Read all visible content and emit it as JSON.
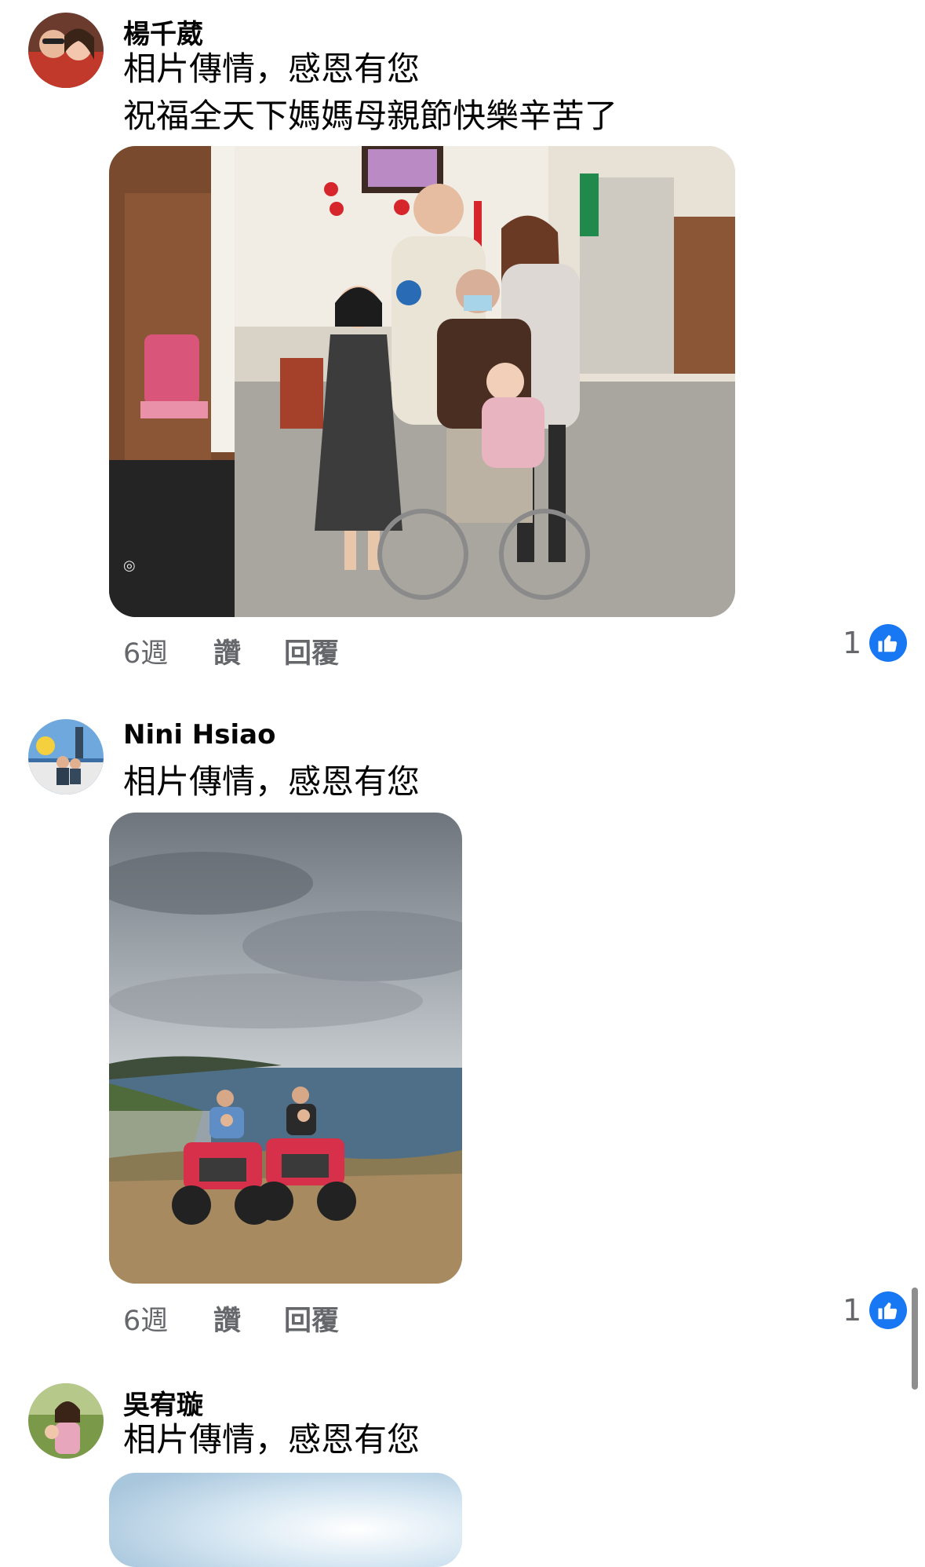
{
  "comments": [
    {
      "author": "楊千葳",
      "lines": [
        "相片傳情，感恩有您",
        "祝福全天下媽媽母親節快樂辛苦了"
      ],
      "time": "6週",
      "like_label": "讚",
      "reply_label": "回覆",
      "reaction_count": "1"
    },
    {
      "author": "Nini Hsiao",
      "lines": [
        "相片傳情，感恩有您"
      ],
      "time": "6週",
      "like_label": "讚",
      "reply_label": "回覆",
      "reaction_count": "1"
    },
    {
      "author": "吳宥璇",
      "lines": [
        "相片傳情，感恩有您"
      ]
    }
  ],
  "colors": {
    "like_blue": "#1877f2",
    "meta_gray": "#65676b"
  },
  "icons": {
    "reaction": "thumbs-up-icon"
  }
}
